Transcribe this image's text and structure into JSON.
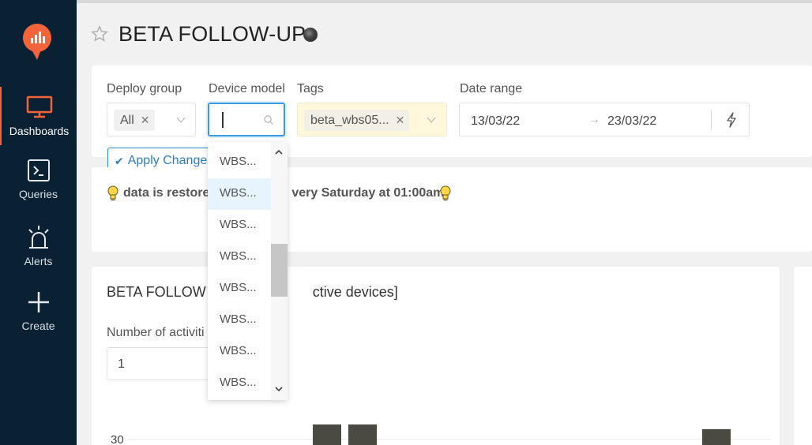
{
  "sidebar": {
    "items": [
      {
        "label": "Dashboards",
        "icon": "monitor-icon",
        "active": true
      },
      {
        "label": "Queries",
        "icon": "terminal-icon"
      },
      {
        "label": "Alerts",
        "icon": "alarm-icon"
      },
      {
        "label": "Create",
        "icon": "plus-icon"
      }
    ]
  },
  "header": {
    "title": "BETA FOLLOW-UP"
  },
  "filters": {
    "deploy_group": {
      "label": "Deploy group",
      "value": "All"
    },
    "device_model": {
      "label": "Device model",
      "value": ""
    },
    "tags": {
      "label": "Tags",
      "value": "beta_wbs05..."
    },
    "date_range": {
      "label": "Date range",
      "start": "13/03/22",
      "end": "23/03/22"
    },
    "apply_label": "Apply Changes"
  },
  "info": {
    "text": "data is restore       very Saturday at 01:00am"
  },
  "widget": {
    "title": "BETA FOLLOW U       ctive devices]",
    "num_label": "Number of activiti",
    "num_value": "1"
  },
  "chart_data": {
    "type": "bar",
    "yticks": [
      "30"
    ]
  },
  "dropdown": {
    "items": [
      "WBS...",
      "WBS...",
      "WBS...",
      "WBS...",
      "WBS...",
      "WBS...",
      "WBS...",
      "WBS..."
    ],
    "hover_index": 1
  },
  "colors": {
    "sidebar_bg": "#0a2033",
    "accent": "#f4643b",
    "primary": "#2d8ed5",
    "tag_field_bg": "#fff8dc",
    "bar": "#4a4a42"
  }
}
